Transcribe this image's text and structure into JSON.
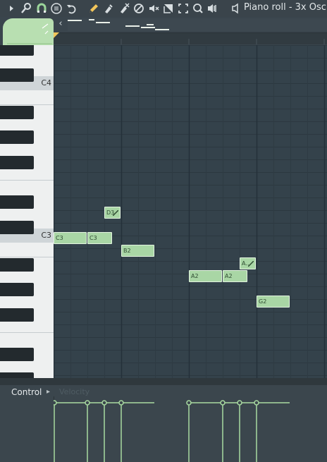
{
  "toolbar": {
    "title": "Piano roll - 3x Osc",
    "icons": [
      "play-arrow-icon",
      "wrench-icon",
      "magnet-icon",
      "menu-icon",
      "undo-icon",
      "pencil-icon",
      "brush-icon",
      "delete-icon",
      "mute-icon",
      "slip-icon",
      "slice-icon",
      "select-icon",
      "zoom-icon",
      "playback-icon",
      "speaker-icon"
    ]
  },
  "colors": {
    "note_fill": "#a9d6a5",
    "note_border": "#e3f4e0",
    "grid_bg": "#34424b",
    "velocity": "#a9dba1",
    "accent_tab": "#b8dfb1"
  },
  "keyboard": {
    "labels": {
      "c4": "C4",
      "c3": "C3"
    }
  },
  "notes": [
    {
      "label": "C3"
    },
    {
      "label": "C3"
    },
    {
      "label": "D3"
    },
    {
      "label": "B2"
    },
    {
      "label": "A2"
    },
    {
      "label": "A2"
    },
    {
      "label": "A..."
    },
    {
      "label": "G2"
    }
  ],
  "control": {
    "label": "Control",
    "parameter": "Velocity"
  }
}
